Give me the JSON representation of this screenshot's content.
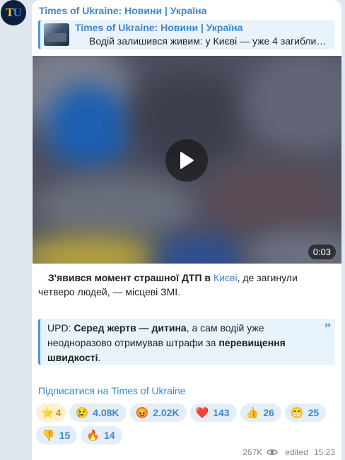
{
  "channel": {
    "name": "Times of Ukraine: Новини | Україна",
    "avatar_text_1": "T",
    "avatar_text_2": "U"
  },
  "reply": {
    "title": "Times of Ukraine: Новини | Україна",
    "text": "Водій залишився живим: у Києві — уже 4 загиблих…"
  },
  "video": {
    "duration": "0:03"
  },
  "caption": {
    "part1": "З'явився момент страшної ДТП в ",
    "link": "Києві",
    "part2": ", де загинули четверо людей, — місцеві ЗМІ."
  },
  "quote": {
    "prefix": "UPD: ",
    "bold1": "Серед жертв — дитина",
    "middle": ", а сам водій уже неодноразово отримував штрафи за ",
    "bold2": "перевищення швидкості",
    "suffix": "."
  },
  "subscribe": {
    "label": "Підписатися на Times of Ukraine"
  },
  "reactions": [
    {
      "emoji": "⭐",
      "count": "4",
      "icon": "star-icon"
    },
    {
      "emoji": "😢",
      "count": "4.08K",
      "icon": "crying-face-icon"
    },
    {
      "emoji": "😡",
      "count": "2.02K",
      "icon": "angry-face-icon"
    },
    {
      "emoji": "❤️",
      "count": "143",
      "icon": "heart-icon"
    },
    {
      "emoji": "👍",
      "count": "26",
      "icon": "thumbs-up-icon"
    },
    {
      "emoji": "😁",
      "count": "25",
      "icon": "grinning-face-icon"
    },
    {
      "emoji": "👎",
      "count": "15",
      "icon": "thumbs-down-icon"
    },
    {
      "emoji": "🔥",
      "count": "14",
      "icon": "fire-icon"
    }
  ],
  "footer": {
    "views": "267K",
    "edited": "edited",
    "time": "15:23"
  },
  "colors": {
    "accent": "#3f88c7",
    "quote_bg": "#e9f3fc",
    "reaction_bg": "#e4eef9",
    "star_bg": "#fdf0d6"
  }
}
